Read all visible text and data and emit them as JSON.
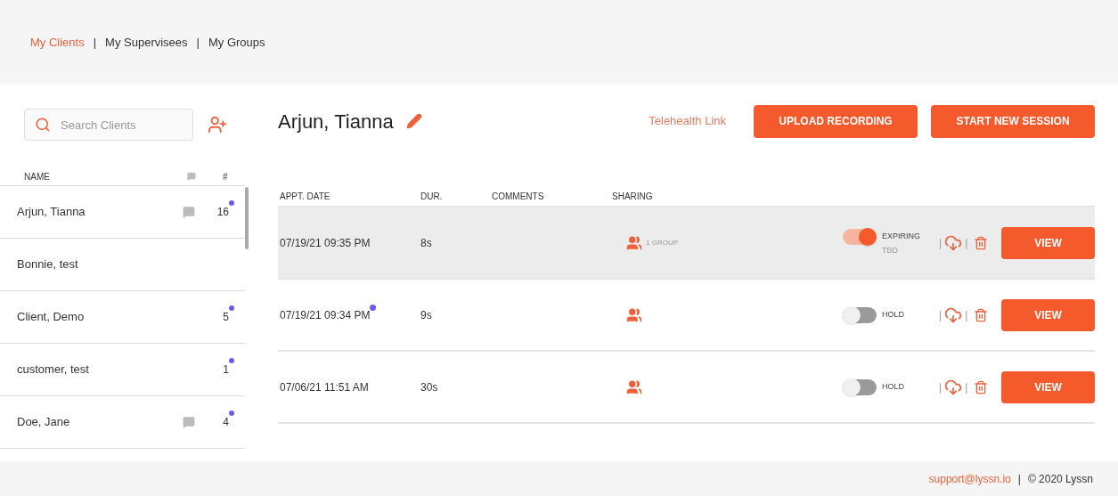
{
  "nav": [
    {
      "label": "My Clients",
      "selected": true
    },
    {
      "label": "My Supervisees",
      "selected": false
    },
    {
      "label": "My Groups",
      "selected": false
    }
  ],
  "nav_separator": "|",
  "search": {
    "placeholder": "Search Clients"
  },
  "client_columns": {
    "name": "NAME",
    "count": "#"
  },
  "clients": [
    {
      "name": "Arjun, Tianna",
      "has_comment": true,
      "count": "16",
      "unread": true
    },
    {
      "name": "Bonnie, test",
      "has_comment": false,
      "unread": false
    },
    {
      "name": "Client, Demo",
      "has_comment": false,
      "count": "5",
      "unread": true
    },
    {
      "name": "customer, test",
      "has_comment": false,
      "count": "1",
      "unread": true
    },
    {
      "name": "Doe, Jane",
      "has_comment": true,
      "count": "4",
      "unread": true
    }
  ],
  "client_title": "Arjun, Tianna",
  "telehealth_link": "Telehealth Link",
  "buttons": [
    "UPLOAD RECORDING",
    "START NEW SESSION"
  ],
  "session_columns": [
    "APPT. DATE",
    "DUR.",
    "COMMENTS",
    "SHARING"
  ],
  "sessions": [
    {
      "date": "07/19/21 09:35 PM",
      "unread": false,
      "duration": "8s",
      "sharing": "1 GROUP",
      "on": true,
      "status": "EXPIRING",
      "status_note": "TBD",
      "highlighted": true,
      "view": "VIEW"
    },
    {
      "date": "07/19/21 09:34 PM",
      "unread": true,
      "duration": "9s",
      "on": false,
      "status": "HOLD",
      "highlighted": false,
      "view": "VIEW"
    },
    {
      "date": "07/06/21 11:51 AM",
      "unread": false,
      "duration": "30s",
      "on": false,
      "status": "HOLD",
      "highlighted": false,
      "view": "VIEW"
    }
  ],
  "action_separator": "|",
  "footer": {
    "email": "support@lyssn.io",
    "separator": "|",
    "copyright": "© 2020 Lyssn"
  }
}
